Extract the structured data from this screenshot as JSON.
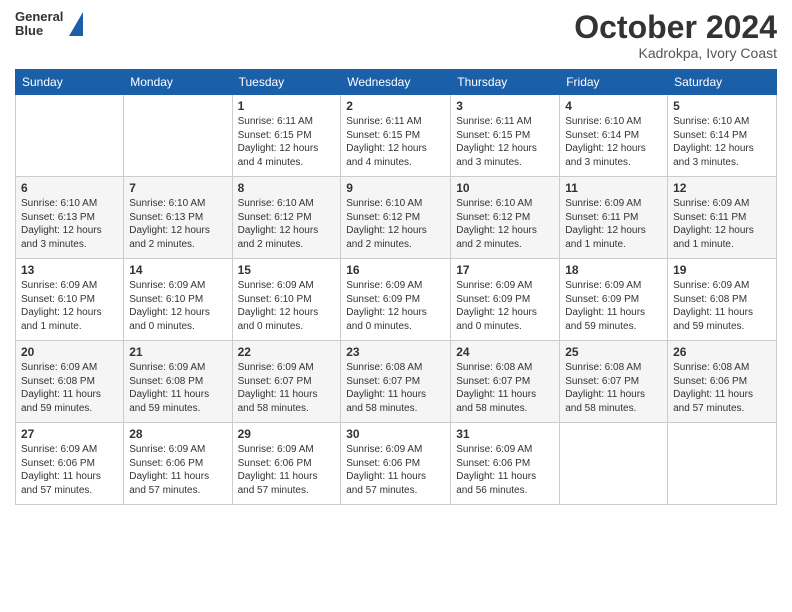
{
  "header": {
    "logo": {
      "line1": "General",
      "line2": "Blue"
    },
    "month": "October 2024",
    "location": "Kadrokpa, Ivory Coast"
  },
  "weekdays": [
    "Sunday",
    "Monday",
    "Tuesday",
    "Wednesday",
    "Thursday",
    "Friday",
    "Saturday"
  ],
  "weeks": [
    [
      {
        "day": "",
        "info": ""
      },
      {
        "day": "",
        "info": ""
      },
      {
        "day": "1",
        "info": "Sunrise: 6:11 AM\nSunset: 6:15 PM\nDaylight: 12 hours\nand 4 minutes."
      },
      {
        "day": "2",
        "info": "Sunrise: 6:11 AM\nSunset: 6:15 PM\nDaylight: 12 hours\nand 4 minutes."
      },
      {
        "day": "3",
        "info": "Sunrise: 6:11 AM\nSunset: 6:15 PM\nDaylight: 12 hours\nand 3 minutes."
      },
      {
        "day": "4",
        "info": "Sunrise: 6:10 AM\nSunset: 6:14 PM\nDaylight: 12 hours\nand 3 minutes."
      },
      {
        "day": "5",
        "info": "Sunrise: 6:10 AM\nSunset: 6:14 PM\nDaylight: 12 hours\nand 3 minutes."
      }
    ],
    [
      {
        "day": "6",
        "info": "Sunrise: 6:10 AM\nSunset: 6:13 PM\nDaylight: 12 hours\nand 3 minutes."
      },
      {
        "day": "7",
        "info": "Sunrise: 6:10 AM\nSunset: 6:13 PM\nDaylight: 12 hours\nand 2 minutes."
      },
      {
        "day": "8",
        "info": "Sunrise: 6:10 AM\nSunset: 6:12 PM\nDaylight: 12 hours\nand 2 minutes."
      },
      {
        "day": "9",
        "info": "Sunrise: 6:10 AM\nSunset: 6:12 PM\nDaylight: 12 hours\nand 2 minutes."
      },
      {
        "day": "10",
        "info": "Sunrise: 6:10 AM\nSunset: 6:12 PM\nDaylight: 12 hours\nand 2 minutes."
      },
      {
        "day": "11",
        "info": "Sunrise: 6:09 AM\nSunset: 6:11 PM\nDaylight: 12 hours\nand 1 minute."
      },
      {
        "day": "12",
        "info": "Sunrise: 6:09 AM\nSunset: 6:11 PM\nDaylight: 12 hours\nand 1 minute."
      }
    ],
    [
      {
        "day": "13",
        "info": "Sunrise: 6:09 AM\nSunset: 6:10 PM\nDaylight: 12 hours\nand 1 minute."
      },
      {
        "day": "14",
        "info": "Sunrise: 6:09 AM\nSunset: 6:10 PM\nDaylight: 12 hours\nand 0 minutes."
      },
      {
        "day": "15",
        "info": "Sunrise: 6:09 AM\nSunset: 6:10 PM\nDaylight: 12 hours\nand 0 minutes."
      },
      {
        "day": "16",
        "info": "Sunrise: 6:09 AM\nSunset: 6:09 PM\nDaylight: 12 hours\nand 0 minutes."
      },
      {
        "day": "17",
        "info": "Sunrise: 6:09 AM\nSunset: 6:09 PM\nDaylight: 12 hours\nand 0 minutes."
      },
      {
        "day": "18",
        "info": "Sunrise: 6:09 AM\nSunset: 6:09 PM\nDaylight: 11 hours\nand 59 minutes."
      },
      {
        "day": "19",
        "info": "Sunrise: 6:09 AM\nSunset: 6:08 PM\nDaylight: 11 hours\nand 59 minutes."
      }
    ],
    [
      {
        "day": "20",
        "info": "Sunrise: 6:09 AM\nSunset: 6:08 PM\nDaylight: 11 hours\nand 59 minutes."
      },
      {
        "day": "21",
        "info": "Sunrise: 6:09 AM\nSunset: 6:08 PM\nDaylight: 11 hours\nand 59 minutes."
      },
      {
        "day": "22",
        "info": "Sunrise: 6:09 AM\nSunset: 6:07 PM\nDaylight: 11 hours\nand 58 minutes."
      },
      {
        "day": "23",
        "info": "Sunrise: 6:08 AM\nSunset: 6:07 PM\nDaylight: 11 hours\nand 58 minutes."
      },
      {
        "day": "24",
        "info": "Sunrise: 6:08 AM\nSunset: 6:07 PM\nDaylight: 11 hours\nand 58 minutes."
      },
      {
        "day": "25",
        "info": "Sunrise: 6:08 AM\nSunset: 6:07 PM\nDaylight: 11 hours\nand 58 minutes."
      },
      {
        "day": "26",
        "info": "Sunrise: 6:08 AM\nSunset: 6:06 PM\nDaylight: 11 hours\nand 57 minutes."
      }
    ],
    [
      {
        "day": "27",
        "info": "Sunrise: 6:09 AM\nSunset: 6:06 PM\nDaylight: 11 hours\nand 57 minutes."
      },
      {
        "day": "28",
        "info": "Sunrise: 6:09 AM\nSunset: 6:06 PM\nDaylight: 11 hours\nand 57 minutes."
      },
      {
        "day": "29",
        "info": "Sunrise: 6:09 AM\nSunset: 6:06 PM\nDaylight: 11 hours\nand 57 minutes."
      },
      {
        "day": "30",
        "info": "Sunrise: 6:09 AM\nSunset: 6:06 PM\nDaylight: 11 hours\nand 57 minutes."
      },
      {
        "day": "31",
        "info": "Sunrise: 6:09 AM\nSunset: 6:06 PM\nDaylight: 11 hours\nand 56 minutes."
      },
      {
        "day": "",
        "info": ""
      },
      {
        "day": "",
        "info": ""
      }
    ]
  ]
}
